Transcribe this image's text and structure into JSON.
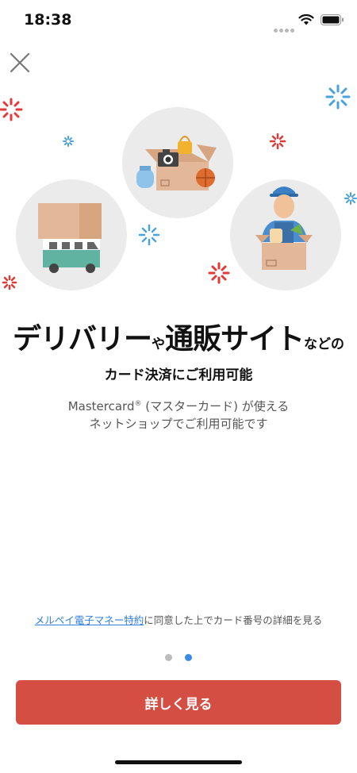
{
  "status_bar": {
    "time": "18:38"
  },
  "headline": {
    "part1": "デリバリー",
    "part2": "や",
    "part3": "通販サイト",
    "part4": "などの"
  },
  "subheadline": "カード決済にご利用可能",
  "description": {
    "line1_prefix": "Mastercard",
    "registered_mark": "®",
    "line1_suffix": " (マスターカード) が使える",
    "line2": "ネットショップでご利用可能です"
  },
  "terms": {
    "link_text": "メルペイ電子マネー特約",
    "rest_text": "に同意した上でカード番号の詳細を見る"
  },
  "pager": {
    "total": 2,
    "active_index": 1
  },
  "primary_button": {
    "label": "詳しく見る"
  },
  "colors": {
    "primary": "#d44e43",
    "link": "#2f7de1",
    "active_dot": "#3d8ae6",
    "inactive_dot": "#bdbdbd",
    "circle_bg": "#ebebeb"
  },
  "icons": {
    "close": "close-icon",
    "wifi": "wifi-icon",
    "battery": "battery-icon"
  }
}
